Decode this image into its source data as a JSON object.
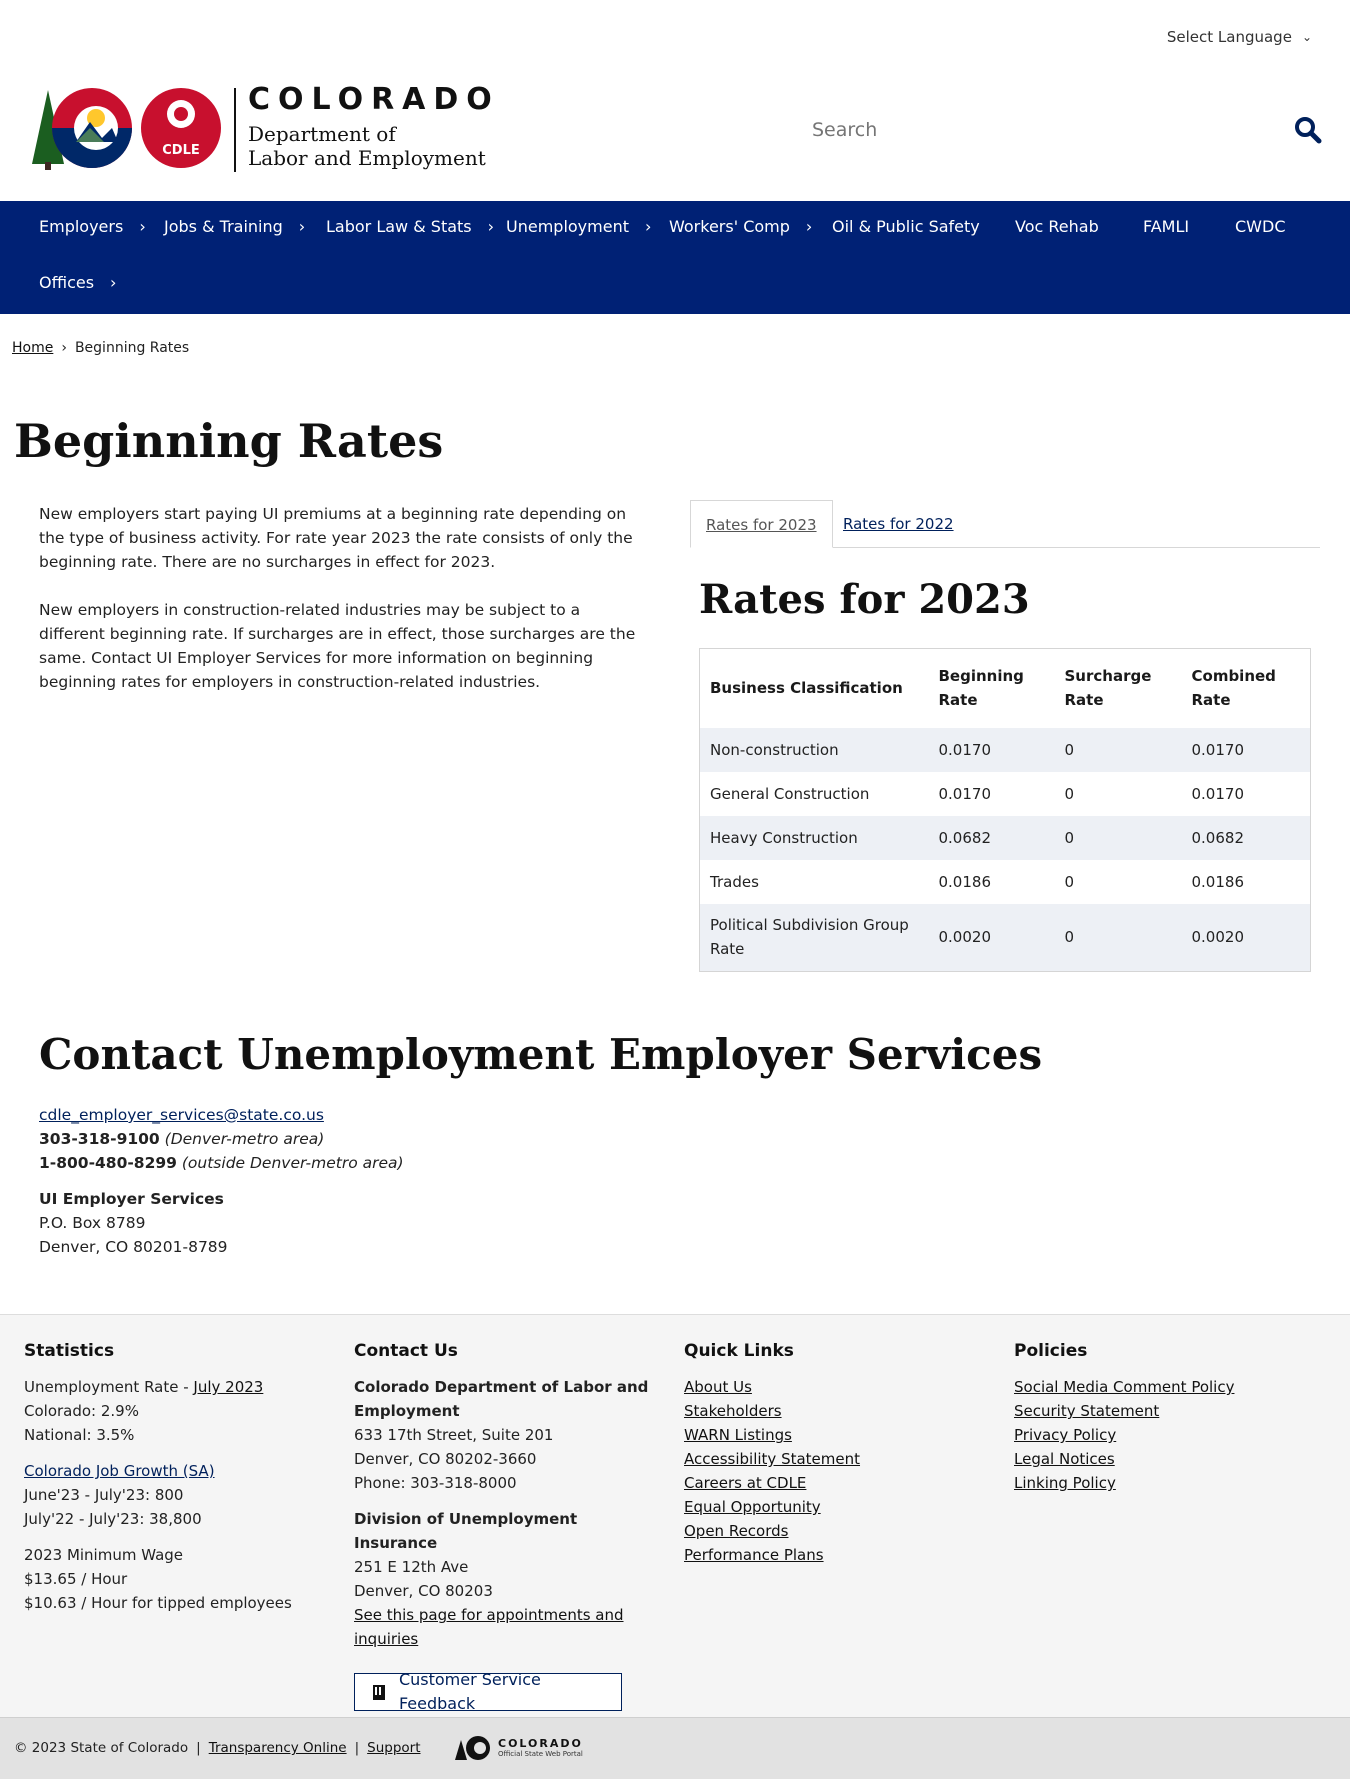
{
  "header": {
    "language_label": "Select Language",
    "logo_wordmark": "COLORADO",
    "logo_dept_line1": "Department of",
    "logo_dept_line2": "Labor and Employment",
    "logo_badge": "CDLE",
    "search_placeholder": "Search"
  },
  "nav": {
    "items": [
      {
        "label": "Employers"
      },
      {
        "label": "Jobs & Training"
      },
      {
        "label": "Labor Law & Stats"
      },
      {
        "label": "Unemployment"
      },
      {
        "label": "Workers' Comp"
      },
      {
        "label": "Oil & Public Safety"
      },
      {
        "label": "Voc Rehab"
      },
      {
        "label": "FAMLI"
      },
      {
        "label": "CWDC"
      },
      {
        "label": "Offices"
      }
    ]
  },
  "breadcrumb": {
    "home": "Home",
    "separator": "›",
    "current": "Beginning Rates"
  },
  "page": {
    "title": "Beginning Rates",
    "intro_p1": "New employers start paying UI premiums at a beginning rate depending on the type of business activity. For rate year 2023 the rate consists of only the beginning rate. There are no surcharges in effect for 2023.",
    "intro_p2": "New employers in construction-related industries may be subject to a different beginning rate. If surcharges are in effect, those surcharges are the same. Contact UI Employer Services for more information on beginning beginning rates for employers in construction-related industries."
  },
  "tabs": {
    "active": "Rates for 2023",
    "inactive": "Rates for 2022"
  },
  "rates": {
    "title": "Rates for 2023",
    "headers": [
      "Business Classification",
      "Beginning Rate",
      "Surcharge Rate",
      "Combined Rate"
    ],
    "rows": [
      [
        "Non-construction",
        "0.0170",
        "0",
        "0.0170"
      ],
      [
        "General Construction",
        "0.0170",
        "0",
        "0.0170"
      ],
      [
        "Heavy Construction",
        "0.0682",
        "0",
        "0.0682"
      ],
      [
        "Trades",
        "0.0186",
        "0",
        "0.0186"
      ],
      [
        "Political Subdivision Group Rate",
        "0.0020",
        "0",
        "0.0020"
      ]
    ]
  },
  "contact": {
    "title": "Contact Unemployment Employer Services",
    "email": "cdle_employer_services@state.co.us",
    "phone1": "303-318-9100",
    "phone1_note": "(Denver-metro area)",
    "phone2": "1-800-480-8299",
    "phone2_note": "(outside Denver-metro area)",
    "org": "UI Employer Services",
    "box": "P.O. Box 8789",
    "city": "Denver, CO 80201-8789"
  },
  "footer": {
    "statistics": {
      "heading": "Statistics",
      "unemp_prefix": "Unemployment Rate - ",
      "unemp_link": "July 2023",
      "colorado": "Colorado: 2.9%",
      "national": "National: 3.5%",
      "growth_link": "Colorado Job Growth (SA)",
      "growth1": "June'23 - July'23: 800",
      "growth2": "July'22 - July'23: 38,800",
      "wage_label": "2023 Minimum Wage",
      "wage1": "$13.65 / Hour",
      "wage2": "$10.63 / Hour for tipped employees"
    },
    "contact_us": {
      "heading": "Contact Us",
      "org_line1": "Colorado Department of Labor and",
      "org_line2": "Employment",
      "addr1": "633 17th Street, Suite 201",
      "addr2": "Denver, CO  80202-3660",
      "phone": "Phone: 303-318-8000",
      "div": "Division of Unemployment Insurance",
      "div_addr1": "251 E 12th Ave",
      "div_addr2": "Denver, CO  80203",
      "appt_link_line1": "See this page for appointments and",
      "appt_link_line2": "inquiries",
      "feedback": "Customer Service Feedback"
    },
    "quick_links": {
      "heading": "Quick Links",
      "links": [
        "About Us",
        "Stakeholders",
        "WARN Listings",
        "Accessibility Statement",
        "Careers at CDLE",
        "Equal Opportunity",
        "Open Records",
        "Performance Plans"
      ]
    },
    "policies": {
      "heading": "Policies",
      "links": [
        "Social Media Comment Policy",
        "Security Statement",
        "Privacy Policy",
        "Legal Notices",
        "Linking Policy"
      ]
    }
  },
  "bottom": {
    "copyright": "© 2023 State of Colorado",
    "sep": "|",
    "transparency": "Transparency Online",
    "support": "Support",
    "portal_word": "COLORADO",
    "portal_sub": "Official State Web Portal"
  },
  "colors": {
    "nav_bg": "#002175",
    "link": "#00205b",
    "table_stripe": "#edf0f5"
  }
}
